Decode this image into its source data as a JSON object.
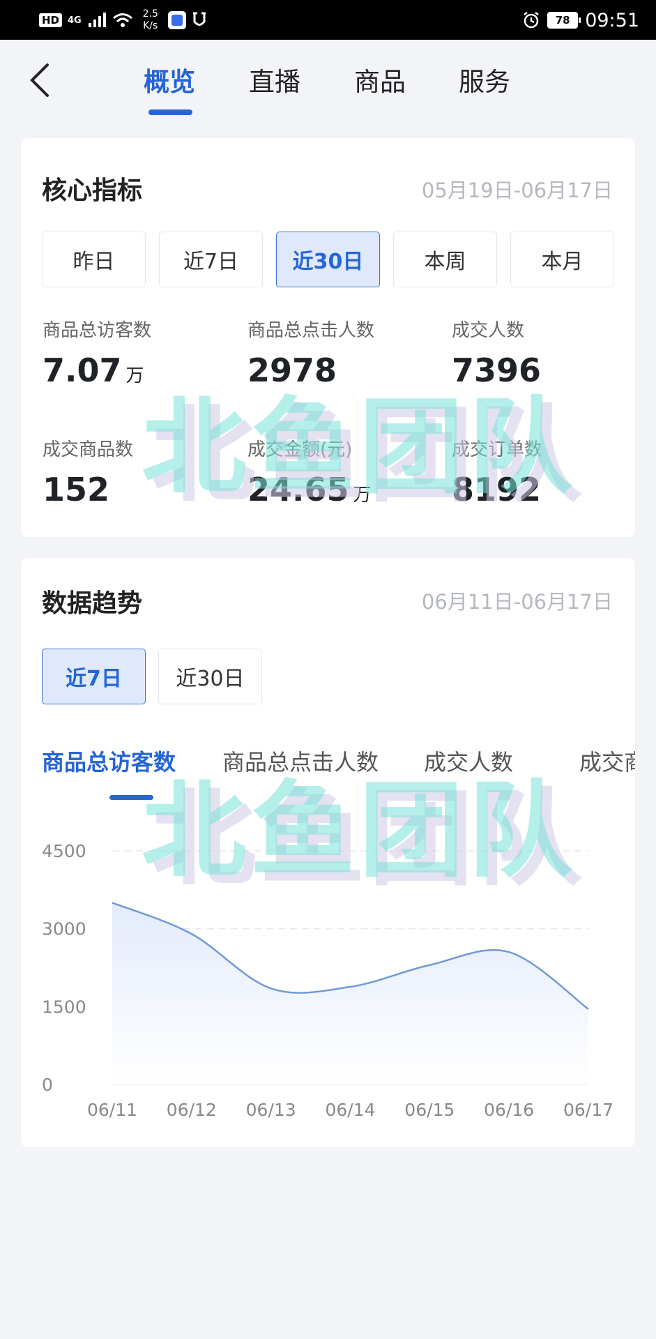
{
  "status_bar": {
    "hd": "HD",
    "network": "4G",
    "speed_value": "2.5",
    "speed_unit": "K/s",
    "battery": "78",
    "time": "09:51"
  },
  "nav": {
    "tabs": [
      "概览",
      "直播",
      "商品",
      "服务"
    ],
    "active_index": 0
  },
  "core": {
    "title": "核心指标",
    "date_range": "05月19日-06月17日",
    "ranges": [
      "昨日",
      "近7日",
      "近30日",
      "本周",
      "本月"
    ],
    "active_range": 2,
    "metrics": [
      {
        "label": "商品总访客数",
        "value": "7.07",
        "unit": "万"
      },
      {
        "label": "商品总点击人数",
        "value": "2978",
        "unit": ""
      },
      {
        "label": "成交人数",
        "value": "7396",
        "unit": ""
      },
      {
        "label": "成交商品数",
        "value": "152",
        "unit": ""
      },
      {
        "label": "成交金额(元)",
        "value": "24.65",
        "unit": "万"
      },
      {
        "label": "成交订单数",
        "value": "8192",
        "unit": ""
      }
    ]
  },
  "trend": {
    "title": "数据趋势",
    "date_range": "06月11日-06月17日",
    "ranges": [
      "近7日",
      "近30日"
    ],
    "active_range": 0,
    "metric_tabs": [
      "商品总访客数",
      "商品总点击人数",
      "成交人数",
      "成交商"
    ],
    "active_metric": 0
  },
  "watermark": "北鱼团队",
  "colors": {
    "accent": "#2565d6",
    "line": "#6f9ad8",
    "area": "#e6eefc",
    "muted": "#b4b8be"
  },
  "chart_data": {
    "type": "area",
    "x": [
      "06/11",
      "06/12",
      "06/13",
      "06/14",
      "06/15",
      "06/16",
      "06/17"
    ],
    "series": [
      {
        "values": [
          3500,
          2900,
          1850,
          1880,
          2300,
          2550,
          1450
        ]
      }
    ],
    "ylim": [
      0,
      4500
    ],
    "yticks": [
      "0",
      "1500",
      "3000",
      "4500"
    ],
    "grid": true
  }
}
